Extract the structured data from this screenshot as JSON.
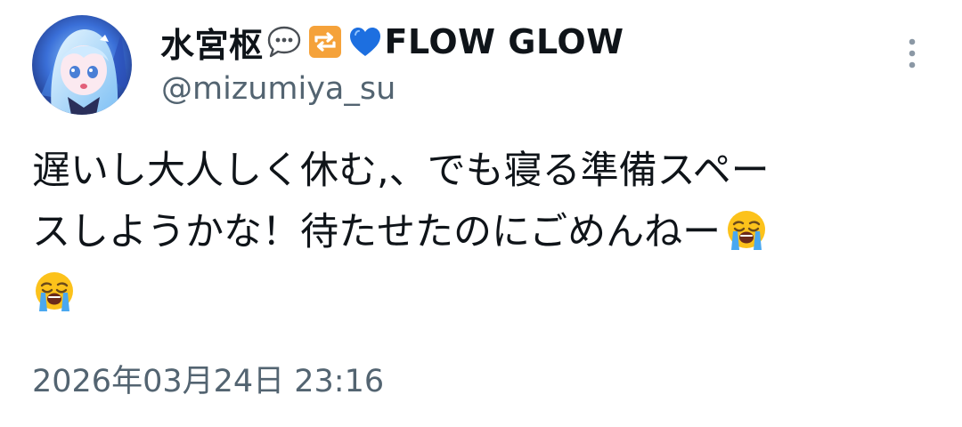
{
  "author": {
    "display_name_text": "水宮枢",
    "display_name_brand": "FLOW GLOW",
    "name_emojis": [
      "speech-balloon-emoji",
      "repeat-arrows-emoji",
      "blue-heart-emoji"
    ],
    "handle": "@mizumiya_su"
  },
  "tweet": {
    "lines": [
      "遅いし大人しく休む,、でも寝る準備スペー",
      "スしようかな！待たせたのにごめんねー",
      ""
    ],
    "emojis": [
      "loudly-crying-face-emoji",
      "loudly-crying-face-emoji"
    ],
    "timestamp": "2026年03月24日 23:16"
  },
  "icons": {
    "more": "vertical-ellipsis-icon"
  },
  "colors": {
    "text_primary": "#0f1419",
    "text_secondary": "#536471",
    "blue_heart": "#1d6fe0",
    "repeat_orange": "#f5a23a"
  }
}
